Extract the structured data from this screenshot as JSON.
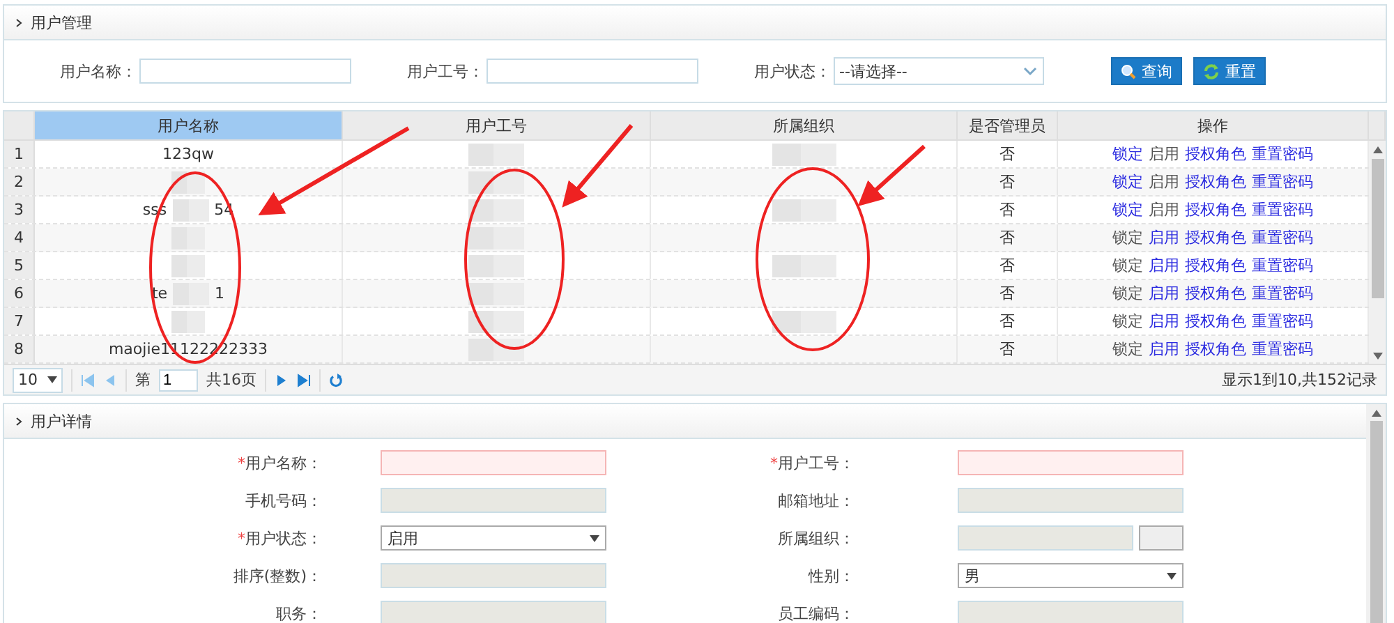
{
  "search_panel": {
    "title": "用户管理",
    "fields": [
      {
        "kind": "text",
        "label": "用户名称："
      },
      {
        "kind": "text",
        "label": "用户工号："
      },
      {
        "kind": "select",
        "label": "用户状态：",
        "value": "--请选择--"
      }
    ],
    "buttons": [
      {
        "kind": "search",
        "label": "查询"
      },
      {
        "kind": "refresh",
        "label": "重置"
      }
    ]
  },
  "table": {
    "columns": [
      {
        "label": "用户名称",
        "selected": true
      },
      {
        "label": "用户工号",
        "selected": false
      },
      {
        "label": "所属组织",
        "selected": false
      },
      {
        "label": "是否管理员",
        "selected": false
      },
      {
        "label": "操作",
        "selected": false
      }
    ],
    "rows": [
      {
        "number": "1",
        "name": [
          "123qw"
        ],
        "admin": "否",
        "actions": [
          {
            "label": "锁定",
            "disabled": false
          },
          {
            "label": "启用",
            "disabled": true
          },
          {
            "label": "授权角色",
            "disabled": false
          },
          {
            "label": "重置密码",
            "disabled": false
          }
        ]
      },
      {
        "number": "2",
        "name": [],
        "admin": "否",
        "actions": [
          {
            "label": "锁定",
            "disabled": false
          },
          {
            "label": "启用",
            "disabled": true
          },
          {
            "label": "授权角色",
            "disabled": false
          },
          {
            "label": "重置密码",
            "disabled": false
          }
        ]
      },
      {
        "number": "3",
        "name": [
          "sss",
          "54"
        ],
        "admin": "否",
        "actions": [
          {
            "label": "锁定",
            "disabled": false
          },
          {
            "label": "启用",
            "disabled": true
          },
          {
            "label": "授权角色",
            "disabled": false
          },
          {
            "label": "重置密码",
            "disabled": false
          }
        ]
      },
      {
        "number": "4",
        "name": [],
        "admin": "否",
        "actions": [
          {
            "label": "锁定",
            "disabled": true
          },
          {
            "label": "启用",
            "disabled": false
          },
          {
            "label": "授权角色",
            "disabled": false
          },
          {
            "label": "重置密码",
            "disabled": false
          }
        ]
      },
      {
        "number": "5",
        "name": [],
        "admin": "否",
        "actions": [
          {
            "label": "锁定",
            "disabled": true
          },
          {
            "label": "启用",
            "disabled": false
          },
          {
            "label": "授权角色",
            "disabled": false
          },
          {
            "label": "重置密码",
            "disabled": false
          }
        ]
      },
      {
        "number": "6",
        "name": [
          "te",
          "1"
        ],
        "admin": "否",
        "actions": [
          {
            "label": "锁定",
            "disabled": true
          },
          {
            "label": "启用",
            "disabled": false
          },
          {
            "label": "授权角色",
            "disabled": false
          },
          {
            "label": "重置密码",
            "disabled": false
          }
        ]
      },
      {
        "number": "7",
        "name": [],
        "admin": "否",
        "actions": [
          {
            "label": "锁定",
            "disabled": true
          },
          {
            "label": "启用",
            "disabled": false
          },
          {
            "label": "授权角色",
            "disabled": false
          },
          {
            "label": "重置密码",
            "disabled": false
          }
        ]
      },
      {
        "number": "8",
        "name": [
          "maojie11122222333"
        ],
        "admin": "否",
        "actions": [
          {
            "label": "锁定",
            "disabled": true
          },
          {
            "label": "启用",
            "disabled": false
          },
          {
            "label": "授权角色",
            "disabled": false
          },
          {
            "label": "重置密码",
            "disabled": false
          }
        ]
      }
    ],
    "highlights": [
      {
        "kind": "ellipse-arrow"
      },
      {
        "kind": "ellipse-arrow"
      },
      {
        "kind": "ellipse-arrow"
      }
    ]
  },
  "pager": {
    "page_size": "10",
    "page_prefix": "第",
    "page": "1",
    "total_pages": "共16页",
    "summary": "显示1到10,共152记录"
  },
  "detail_panel": {
    "title": "用户详情",
    "rows": [
      [
        {
          "marker": "*",
          "label": "用户名称：",
          "kind": "input"
        },
        {
          "marker": "*",
          "label": "用户工号：",
          "kind": "input"
        }
      ],
      [
        {
          "label": "手机号码：",
          "kind": "readonly"
        },
        {
          "label": "邮箱地址：",
          "kind": "readonly"
        }
      ],
      [
        {
          "marker": "*",
          "label": "用户状态：",
          "kind": "select",
          "value": "启用"
        },
        {
          "label": "所属组织：",
          "kind": "picker"
        }
      ],
      [
        {
          "label": "排序(整数)：",
          "kind": "readonly"
        },
        {
          "label": "性别：",
          "kind": "select",
          "value": "男"
        }
      ],
      [
        {
          "label": "职务：",
          "kind": "readonly"
        },
        {
          "label": "员工编码：",
          "kind": "readonly"
        }
      ]
    ]
  }
}
